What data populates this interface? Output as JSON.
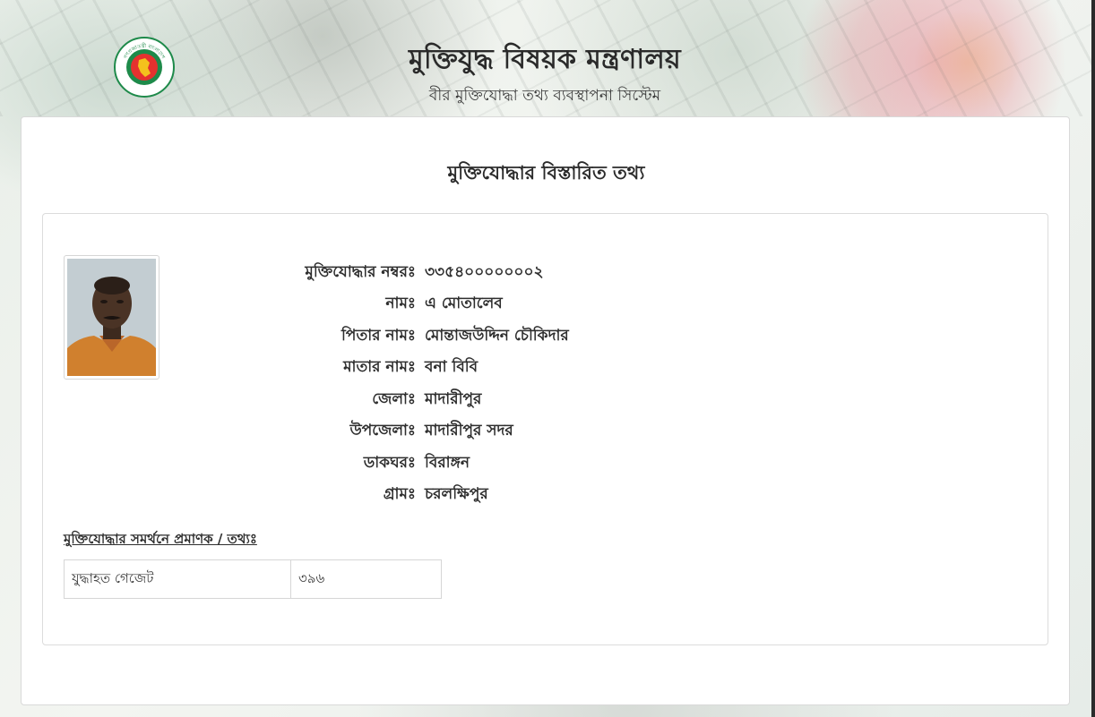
{
  "header": {
    "title": "মুক্তিযুদ্ধ বিষয়ক মন্ত্রণালয়",
    "subtitle": "বীর মুক্তিযোদ্ধা তথ্য ব্যবস্থাপনা সিস্টেম",
    "logo": {
      "icon": "government-seal-icon",
      "ring_text_top": "গণপ্রজাতন্ত্রী বাংলাদেশ",
      "ring_text_bottom": "সরকার"
    }
  },
  "page": {
    "title": "মুক্তিযোদ্ধার বিস্তারিত তথ্য"
  },
  "profile": {
    "fields": [
      {
        "label": "মুক্তিযোদ্ধার নম্বরঃ",
        "value": "৩৩৫৪০০০০০০০২"
      },
      {
        "label": "নামঃ",
        "value": "এ মোতালেব"
      },
      {
        "label": "পিতার নামঃ",
        "value": "মোন্তাজউদ্দিন চৌকিদার"
      },
      {
        "label": "মাতার নামঃ",
        "value": "বনা বিবি"
      },
      {
        "label": "জেলাঃ",
        "value": "মাদারীপুর"
      },
      {
        "label": "উপজেলাঃ",
        "value": "মাদারীপুর সদর"
      },
      {
        "label": "ডাকঘরঃ",
        "value": "বিরাঙ্গন"
      },
      {
        "label": "গ্রামঃ",
        "value": "চরলক্ষিপুর"
      }
    ]
  },
  "proof": {
    "heading": "মুক্তিযোদ্ধার সমর্থনে প্রমাণক / তথ্যঃ",
    "rows": [
      {
        "source": "যুদ্ধাহত গেজেট",
        "number": "৩৯৬"
      }
    ]
  },
  "colors": {
    "seal_green": "#1e8a4a",
    "seal_red": "#e5312f",
    "text": "#2e2e2e"
  }
}
